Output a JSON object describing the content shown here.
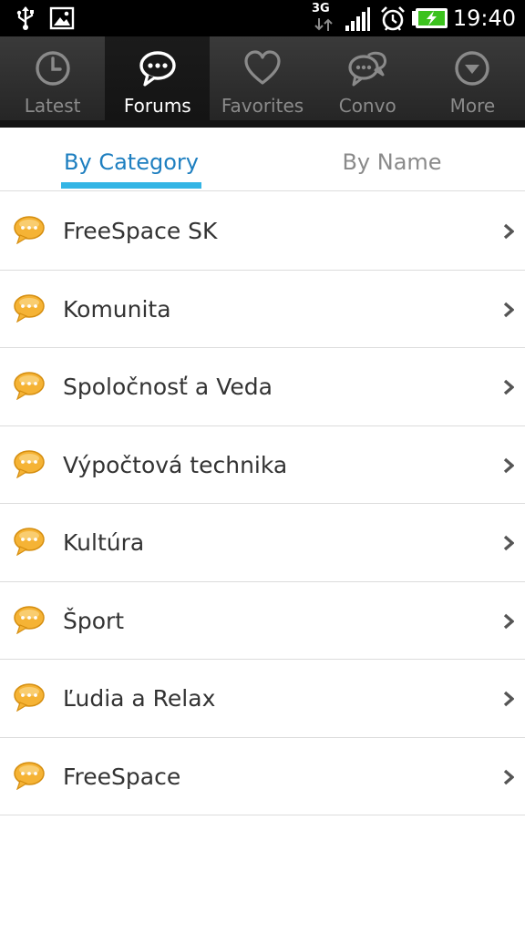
{
  "status_bar": {
    "network": "3G",
    "time": "19:40",
    "icons": [
      "usb-icon",
      "image-icon",
      "signal-icon",
      "alarm-icon",
      "battery-charging-icon"
    ]
  },
  "top_tabs": [
    {
      "label": "Latest",
      "icon": "clock-icon",
      "active": false
    },
    {
      "label": "Forums",
      "icon": "speech-bubble-icon",
      "active": true
    },
    {
      "label": "Favorites",
      "icon": "heart-icon",
      "active": false
    },
    {
      "label": "Convo",
      "icon": "conversation-icon",
      "active": false
    },
    {
      "label": "More",
      "icon": "chevron-down-circle-icon",
      "active": false
    }
  ],
  "sub_tabs": [
    {
      "label": "By Category",
      "active": true
    },
    {
      "label": "By Name",
      "active": false
    }
  ],
  "forums": [
    {
      "label": "FreeSpace SK"
    },
    {
      "label": "Komunita"
    },
    {
      "label": "Spoločnosť a Veda"
    },
    {
      "label": "Výpočtová technika"
    },
    {
      "label": "Kultúra"
    },
    {
      "label": "Šport"
    },
    {
      "label": "Ľudia a Relax"
    },
    {
      "label": "FreeSpace"
    }
  ],
  "colors": {
    "accent": "#33b5e5",
    "active_subtab_text": "#1e7fc0",
    "bubble": "#f5b335"
  }
}
